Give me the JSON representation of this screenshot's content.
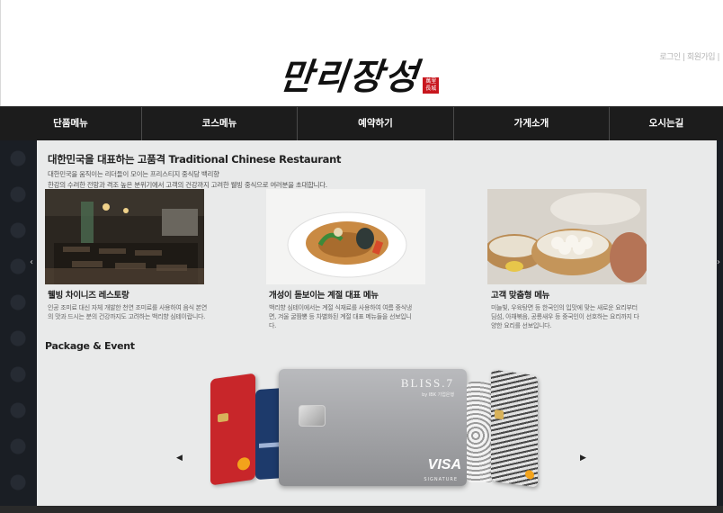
{
  "header": {
    "util_links": [
      "로그인",
      "회원가입"
    ],
    "logo_text": "만리장성",
    "seal_text": "萬里\n長城"
  },
  "nav": {
    "items": [
      "단품메뉴",
      "코스메뉴",
      "예약하기",
      "가게소개",
      "오시는길"
    ]
  },
  "intro": {
    "title": "대한민국을 대표하는 고품격 Traditional Chinese Restaurant",
    "line1": "대한민국을 움직이는 리더들이 모이는 프리스티지 중식당 백리향",
    "line2": "한강의 수려한 전망과 격조 높은 분위기에서 고객의 건강까지 고려한 웰빙 중식으로 여러분을 초대합니다."
  },
  "features": [
    {
      "title": "웰빙 차이니즈 레스토랑",
      "desc": "인공 조미료 대신 자체 개발한 천연 조미료를 사용하여 음식 본연의 맛과 드시는 분의 건강까지도 고려하는 백리향 심테이랍니다."
    },
    {
      "title": "개성이 돋보이는 계절 대표 메뉴",
      "desc": "백리향 심테이에서는 계절 식재료를 사용하여 여름 중식냉면, 겨울 굴짬뽕 등 차별화된 계절 대표 메뉴들을 선보입니다."
    },
    {
      "title": "고객 맞춤형 메뉴",
      "desc": "미늘빛, 우육탕면 등 한국인의 입맛에 맞는 새로운 요리부터 딤섬, 아채볶음, 공룡새우 등 중국인이 선호하는 요리까지 다양한 요리를 선보입니다."
    }
  ],
  "package": {
    "title": "Package & Event",
    "prev_icon": "◀",
    "next_icon": "▶",
    "cards": [
      {
        "label": "",
        "color": "#c8262a"
      },
      {
        "label": "",
        "color": "#1d3a6b"
      },
      {
        "label": "BLISS.7",
        "sub": "by IBK 기업은행",
        "brand": "VISA",
        "brand_sub": "SIGNATURE",
        "color": "#a9aaad"
      },
      {
        "label": "",
        "color": "#e8e8e8"
      },
      {
        "label": "",
        "color": "#6d6d6d"
      }
    ]
  },
  "colors": {
    "nav_bg": "#1c1c1c",
    "panel_bg": "#e9eaea",
    "stage_bg": "#1a1e24",
    "accent_red": "#c8161d"
  }
}
